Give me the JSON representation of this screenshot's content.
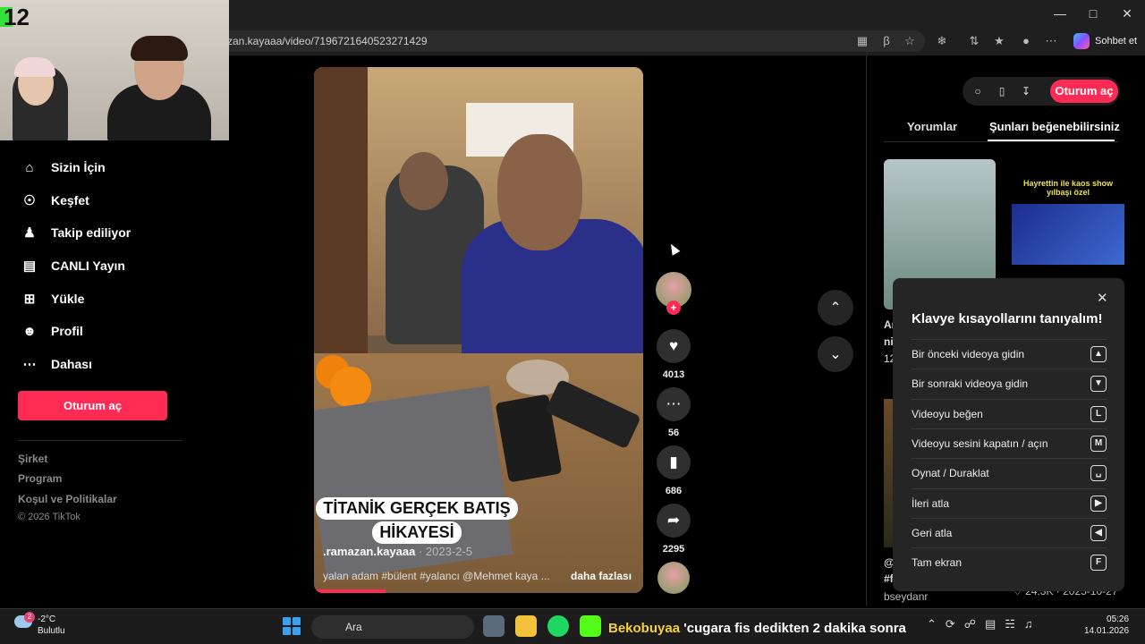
{
  "browser": {
    "url": "zan.kayaaa/video/7196721640523271429",
    "chat_label": "Sohbet et",
    "window_controls": [
      "minimize-icon",
      "maximize-icon",
      "close-icon"
    ]
  },
  "overlay": {
    "cam_number": "12"
  },
  "sidebar": {
    "items": [
      {
        "label": "Sizin İçin",
        "icon": "home-icon"
      },
      {
        "label": "Keşfet",
        "icon": "compass-icon"
      },
      {
        "label": "Takip ediliyor",
        "icon": "following-icon"
      },
      {
        "label": "CANLI Yayın",
        "icon": "live-icon"
      },
      {
        "label": "Yükle",
        "icon": "upload-icon"
      },
      {
        "label": "Profil",
        "icon": "profile-icon"
      },
      {
        "label": "Dahası",
        "icon": "more-icon"
      }
    ],
    "login_label": "Oturum aç",
    "footer": [
      "Şirket",
      "Program",
      "Koşul ve Politikalar",
      "© 2026 TikTok"
    ]
  },
  "video": {
    "caption_line1": "TİTANİK GERÇEK BATIŞ",
    "caption_line2": "HİKAYESİ",
    "author": ".ramazan.kayaaa",
    "date": " · 2023-2-5",
    "description": "yalan adam  #bülent  #yalancı @Mehmet kaya ...",
    "more_label": "daha fazlası"
  },
  "actions": {
    "likes": "4013",
    "comments": "56",
    "saves": "686",
    "shares": "2295"
  },
  "right": {
    "login_label": "Oturum aç",
    "tabs": [
      "Yorumlar",
      "Şunları beğenebilirsiniz"
    ],
    "thumb2_title": "Hayrettin ile kaos show yılbaşı özel",
    "partial_lines": [
      "Ar",
      "ni",
      "12",
      "@",
      "#f"
    ],
    "author3": "bseydanr",
    "stats3": "♡ 24.3K · 2025-10-27"
  },
  "shortcuts": {
    "title": "Klavye kısayollarını tanıyalım!",
    "rows": [
      {
        "label": "Bir önceki videoya gidin",
        "key": "▲"
      },
      {
        "label": "Bir sonraki videoya gidin",
        "key": "▼"
      },
      {
        "label": "Videoyu beğen",
        "key": "L"
      },
      {
        "label": "Videoyu sesini kapatın / açın",
        "key": "M"
      },
      {
        "label": "Oynat / Duraklat",
        "key": "␣"
      },
      {
        "label": "İleri atla",
        "key": "▶"
      },
      {
        "label": "Geri atla",
        "key": "◀"
      },
      {
        "label": "Tam ekran",
        "key": "F"
      }
    ]
  },
  "taskbar": {
    "weather_temp": "-2°C",
    "weather_desc": "Bulutlu",
    "weather_badge": "2",
    "search_placeholder": "Ara",
    "ticker_brand": "Bekobuyaa",
    "ticker_text": "'cugara fis dedikten 2 dakika sonra",
    "time": "05:26",
    "date": "14.01.2026"
  },
  "colors": {
    "accent": "#fe2c55",
    "background": "#000000"
  }
}
